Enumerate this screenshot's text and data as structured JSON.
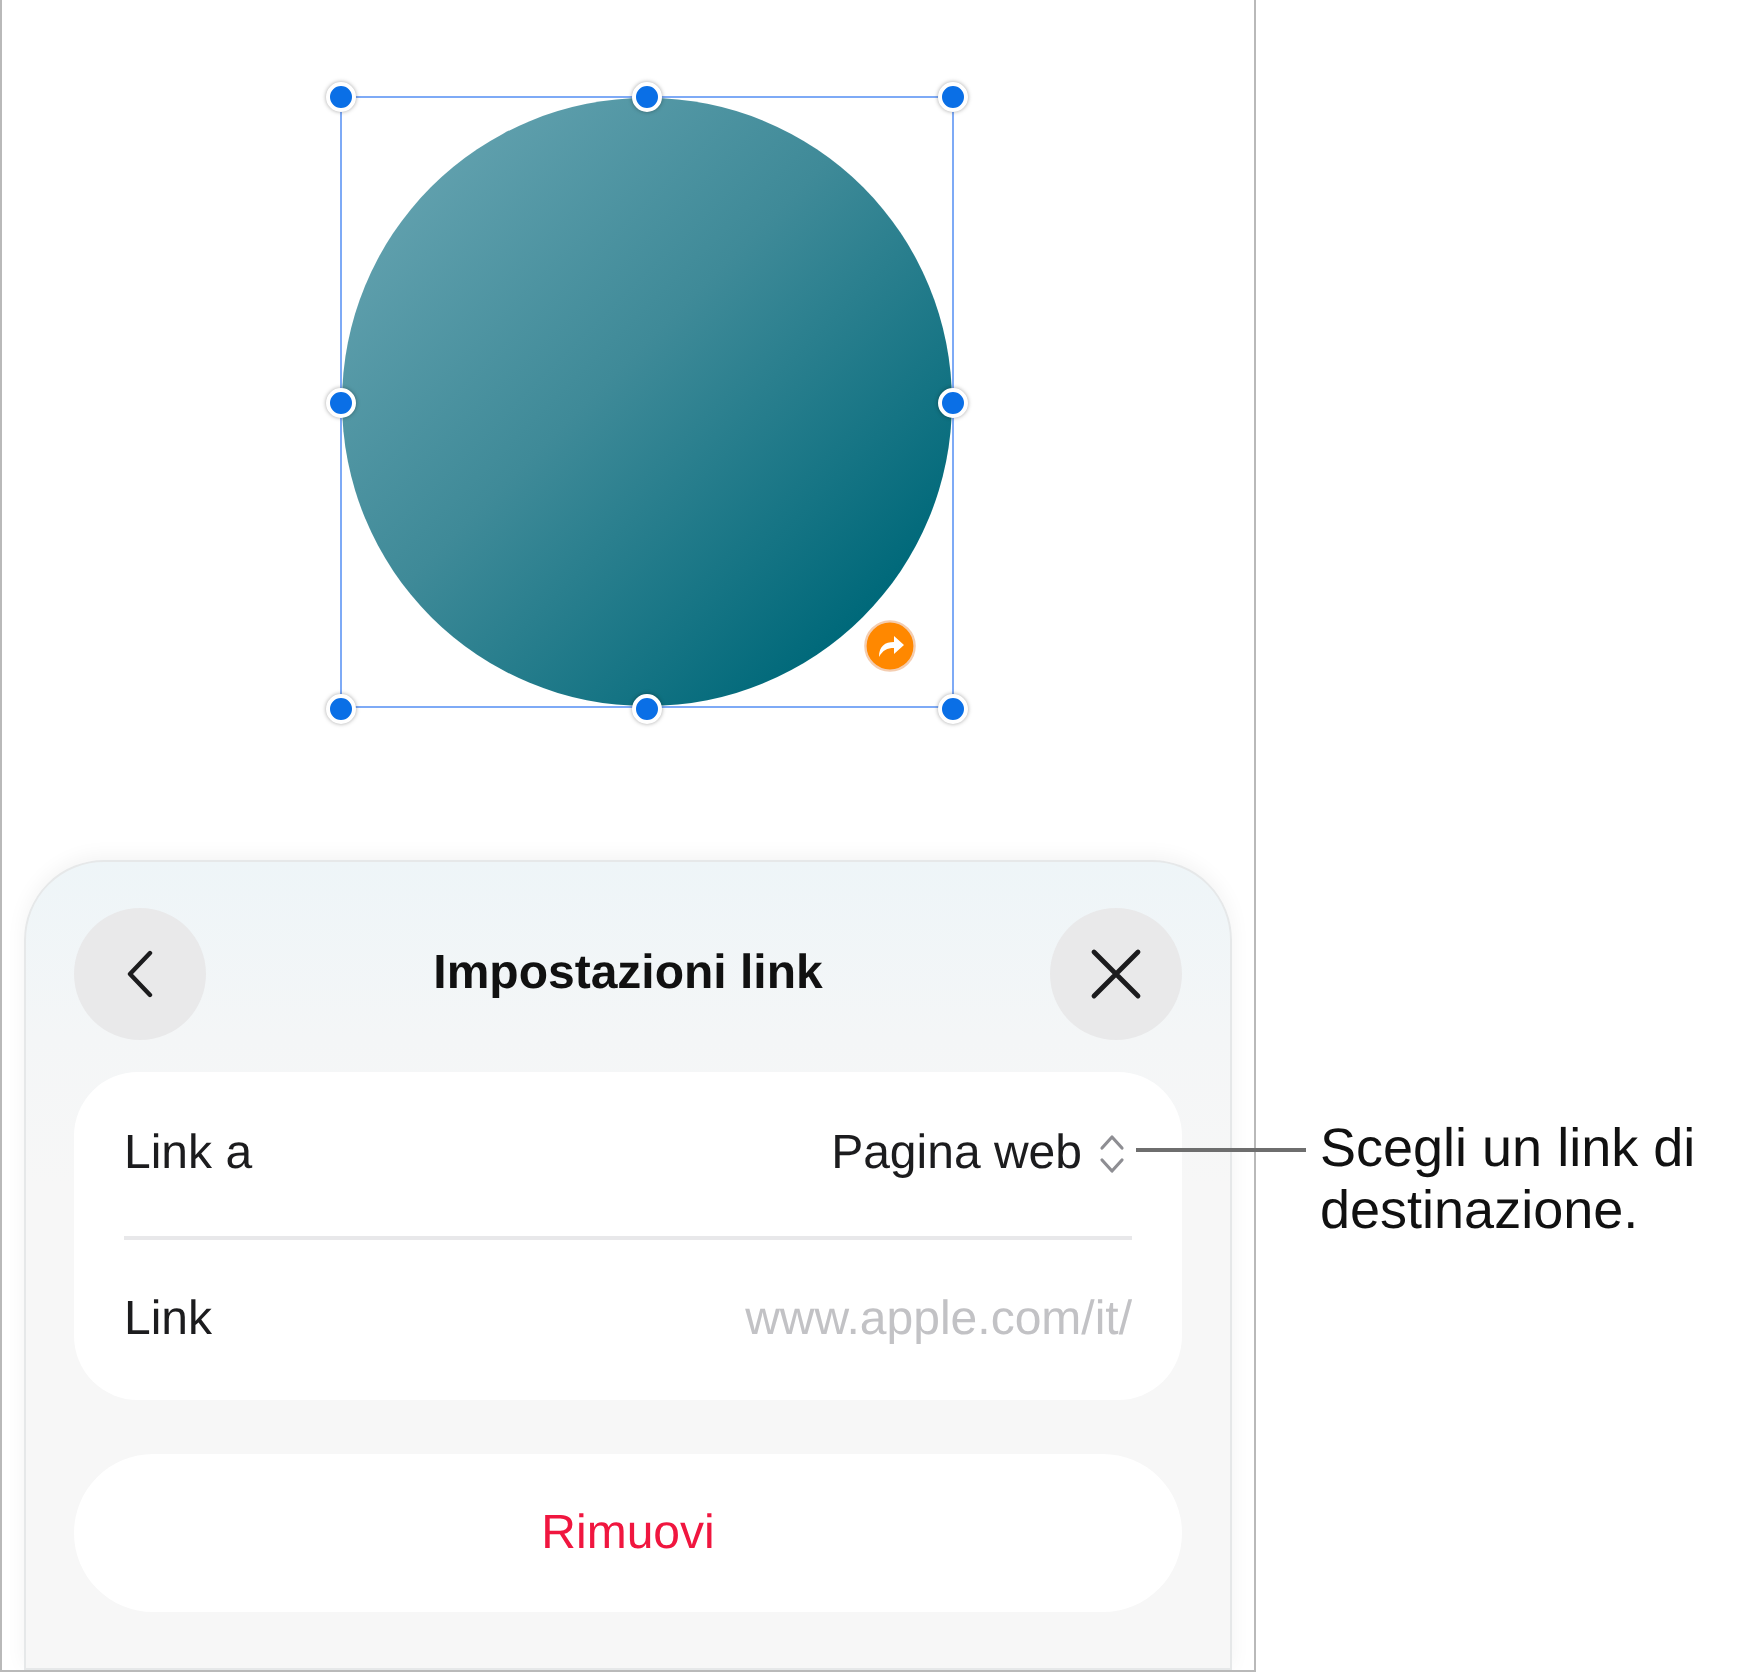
{
  "canvas": {
    "shape": {
      "kind": "circle",
      "selected": true
    }
  },
  "sheet": {
    "title": "Impostazioni link",
    "rows": [
      {
        "kind": "popup",
        "label": "Link a",
        "value": "Pagina web"
      },
      {
        "kind": "field",
        "label": "Link",
        "placeholder": "www.apple.com/it/"
      }
    ],
    "remove_button": "Rimuovi"
  },
  "callout": {
    "text": "Scegli un link di destinazione."
  }
}
